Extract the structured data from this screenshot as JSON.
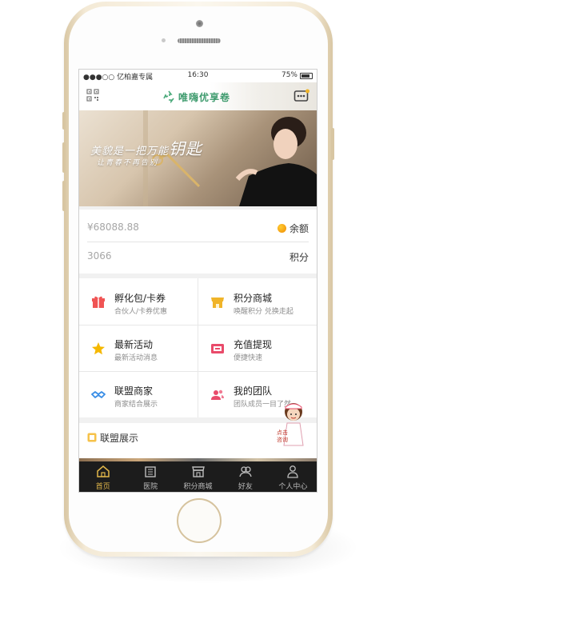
{
  "status_bar": {
    "carrier": "●●●○○ 亿柏嘉专属",
    "time": "16:30",
    "battery": "75%"
  },
  "header": {
    "logo_text": "唯嗨优享卷",
    "qr_icon": "qr-code-icon",
    "message_icon": "message-icon"
  },
  "banner": {
    "line1": "美貌是一把万能",
    "line1_big": "钥匙",
    "line2": "让青春不再告别"
  },
  "balance": {
    "amount": "¥68088.88",
    "amount_label": "余额",
    "points": "3066",
    "points_label": "积分"
  },
  "grid": [
    {
      "title": "孵化包/卡券",
      "sub": "合伙人/卡券优惠",
      "icon": "gift-icon",
      "color": "#f05454"
    },
    {
      "title": "积分商城",
      "sub": "唤醒积分 兑换走起",
      "icon": "shop-icon",
      "color": "#f0b429"
    },
    {
      "title": "最新活动",
      "sub": "最新活动消息",
      "icon": "star-icon",
      "color": "#f5b800"
    },
    {
      "title": "充值提现",
      "sub": "便捷快速",
      "icon": "card-icon",
      "color": "#e94b6a"
    },
    {
      "title": "联盟商家",
      "sub": "商家结合展示",
      "icon": "handshake-icon",
      "color": "#3a8ee6"
    },
    {
      "title": "我的团队",
      "sub": "团队成员一目了然",
      "icon": "team-icon",
      "color": "#e94b6a"
    }
  ],
  "alliance": {
    "label": "联盟展示",
    "mascot_label": "点击咨询"
  },
  "tabbar": [
    {
      "label": "首页",
      "icon": "home-icon",
      "active": true
    },
    {
      "label": "医院",
      "icon": "hospital-icon",
      "active": false
    },
    {
      "label": "积分商城",
      "icon": "store-icon",
      "active": false
    },
    {
      "label": "好友",
      "icon": "friends-icon",
      "active": false
    },
    {
      "label": "个人中心",
      "icon": "user-icon",
      "active": false
    }
  ],
  "colors": {
    "accent_gold": "#e2b74a",
    "tabbar_bg": "#1c1c1c",
    "logo_green": "#3f9b6e"
  }
}
